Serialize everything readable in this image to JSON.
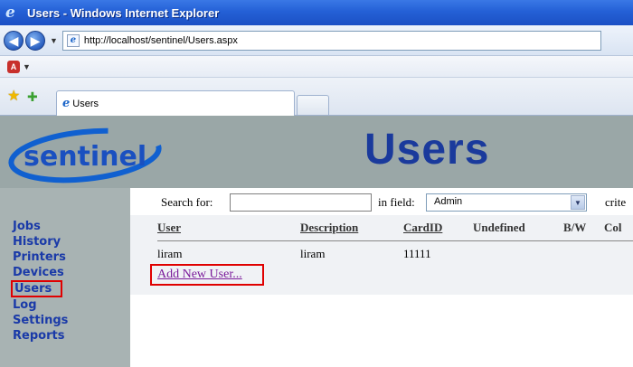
{
  "window": {
    "title": "Users - Windows Internet Explorer",
    "url": "http://localhost/sentinel/Users.aspx",
    "tab_label": "Users"
  },
  "site": {
    "logo_text": "sentinel",
    "page_title": "Users"
  },
  "sidebar": {
    "items": [
      {
        "label": "Jobs"
      },
      {
        "label": "History"
      },
      {
        "label": "Printers"
      },
      {
        "label": "Devices"
      },
      {
        "label": "Users",
        "selected": true
      },
      {
        "label": "Log"
      },
      {
        "label": "Settings"
      },
      {
        "label": "Reports"
      }
    ]
  },
  "search": {
    "search_label": "Search for:",
    "search_value": "",
    "field_label": "in field:",
    "field_value": "Admin",
    "criteria_label": "crite"
  },
  "table": {
    "columns": [
      "User",
      "Description",
      "CardID",
      "Undefined",
      "B/W",
      "Col"
    ],
    "rows": [
      {
        "user": "liram",
        "description": "liram",
        "cardid": "11111"
      }
    ]
  },
  "actions": {
    "add_user": "Add New User..."
  },
  "colors": {
    "accent_blue": "#1a3a9c",
    "highlight_red": "#e00000",
    "band_gray": "#9aa7a7"
  }
}
